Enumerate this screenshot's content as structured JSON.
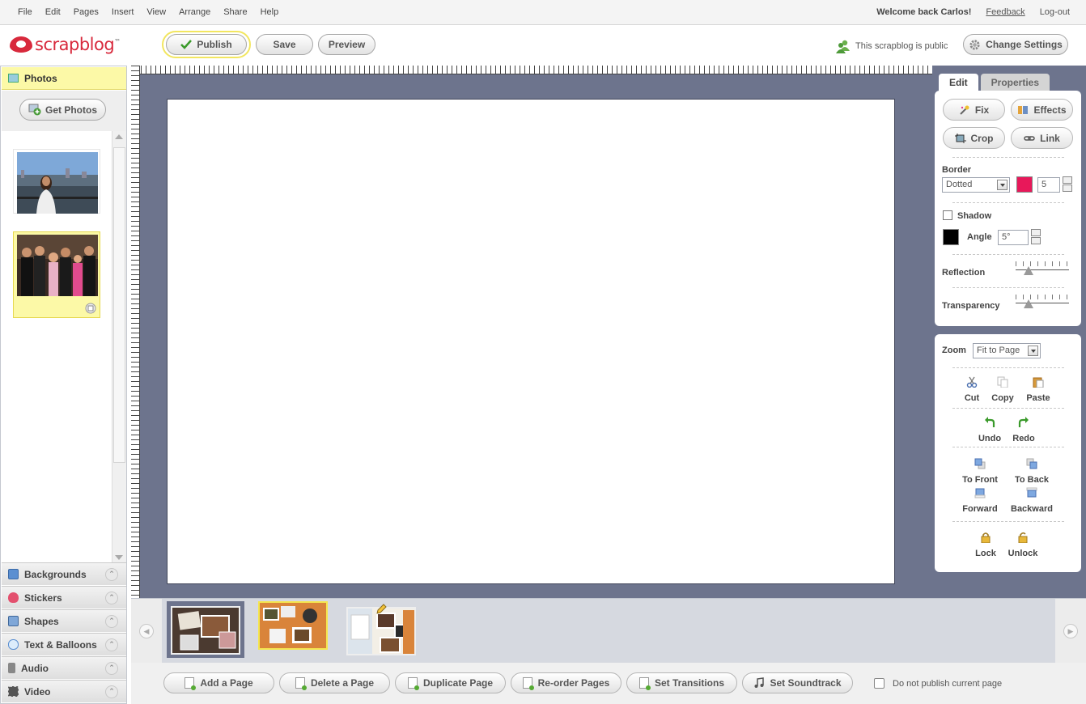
{
  "menu": {
    "items": [
      "File",
      "Edit",
      "Pages",
      "Insert",
      "View",
      "Arrange",
      "Share",
      "Help"
    ],
    "welcome": "Welcome back Carlos!",
    "feedback": "Feedback",
    "logout": "Log-out"
  },
  "brand": {
    "name": "scrapblog",
    "tm": "™",
    "color": "#d8293c"
  },
  "toolbar": {
    "publish": "Publish",
    "save": "Save",
    "preview": "Preview",
    "public_status": "This scrapblog is public",
    "change_settings": "Change Settings"
  },
  "left": {
    "photos_title": "Photos",
    "get_photos": "Get Photos",
    "accordion": [
      "Backgrounds",
      "Stickers",
      "Shapes",
      "Text & Balloons",
      "Audio",
      "Video"
    ]
  },
  "right": {
    "tabs": [
      "Edit",
      "Properties"
    ],
    "buttons": {
      "fix": "Fix",
      "effects": "Effects",
      "crop": "Crop",
      "link": "Link"
    },
    "border_label": "Border",
    "border_style": "Dotted",
    "border_color": "#e8185a",
    "border_width": "5",
    "shadow_label": "Shadow",
    "shadow_color": "#000000",
    "angle_label": "Angle",
    "angle_value": "5°",
    "reflection_label": "Reflection",
    "transparency_label": "Transparency",
    "zoom_label": "Zoom",
    "zoom_value": "Fit to Page",
    "actions": {
      "cut": "Cut",
      "copy": "Copy",
      "paste": "Paste",
      "undo": "Undo",
      "redo": "Redo",
      "to_front": "To Front",
      "to_back": "To Back",
      "forward": "Forward",
      "backward": "Backward",
      "lock": "Lock",
      "unlock": "Unlock"
    }
  },
  "bottom": {
    "buttons": [
      "Add a Page",
      "Delete a Page",
      "Duplicate Page",
      "Re-order Pages",
      "Set Transitions",
      "Set Soundtrack"
    ],
    "no_publish": "Do not publish current page"
  },
  "colors": {
    "canvas_bg": "#6d748d",
    "highlight": "#fcf9a7",
    "accent_red": "#d8293c"
  }
}
